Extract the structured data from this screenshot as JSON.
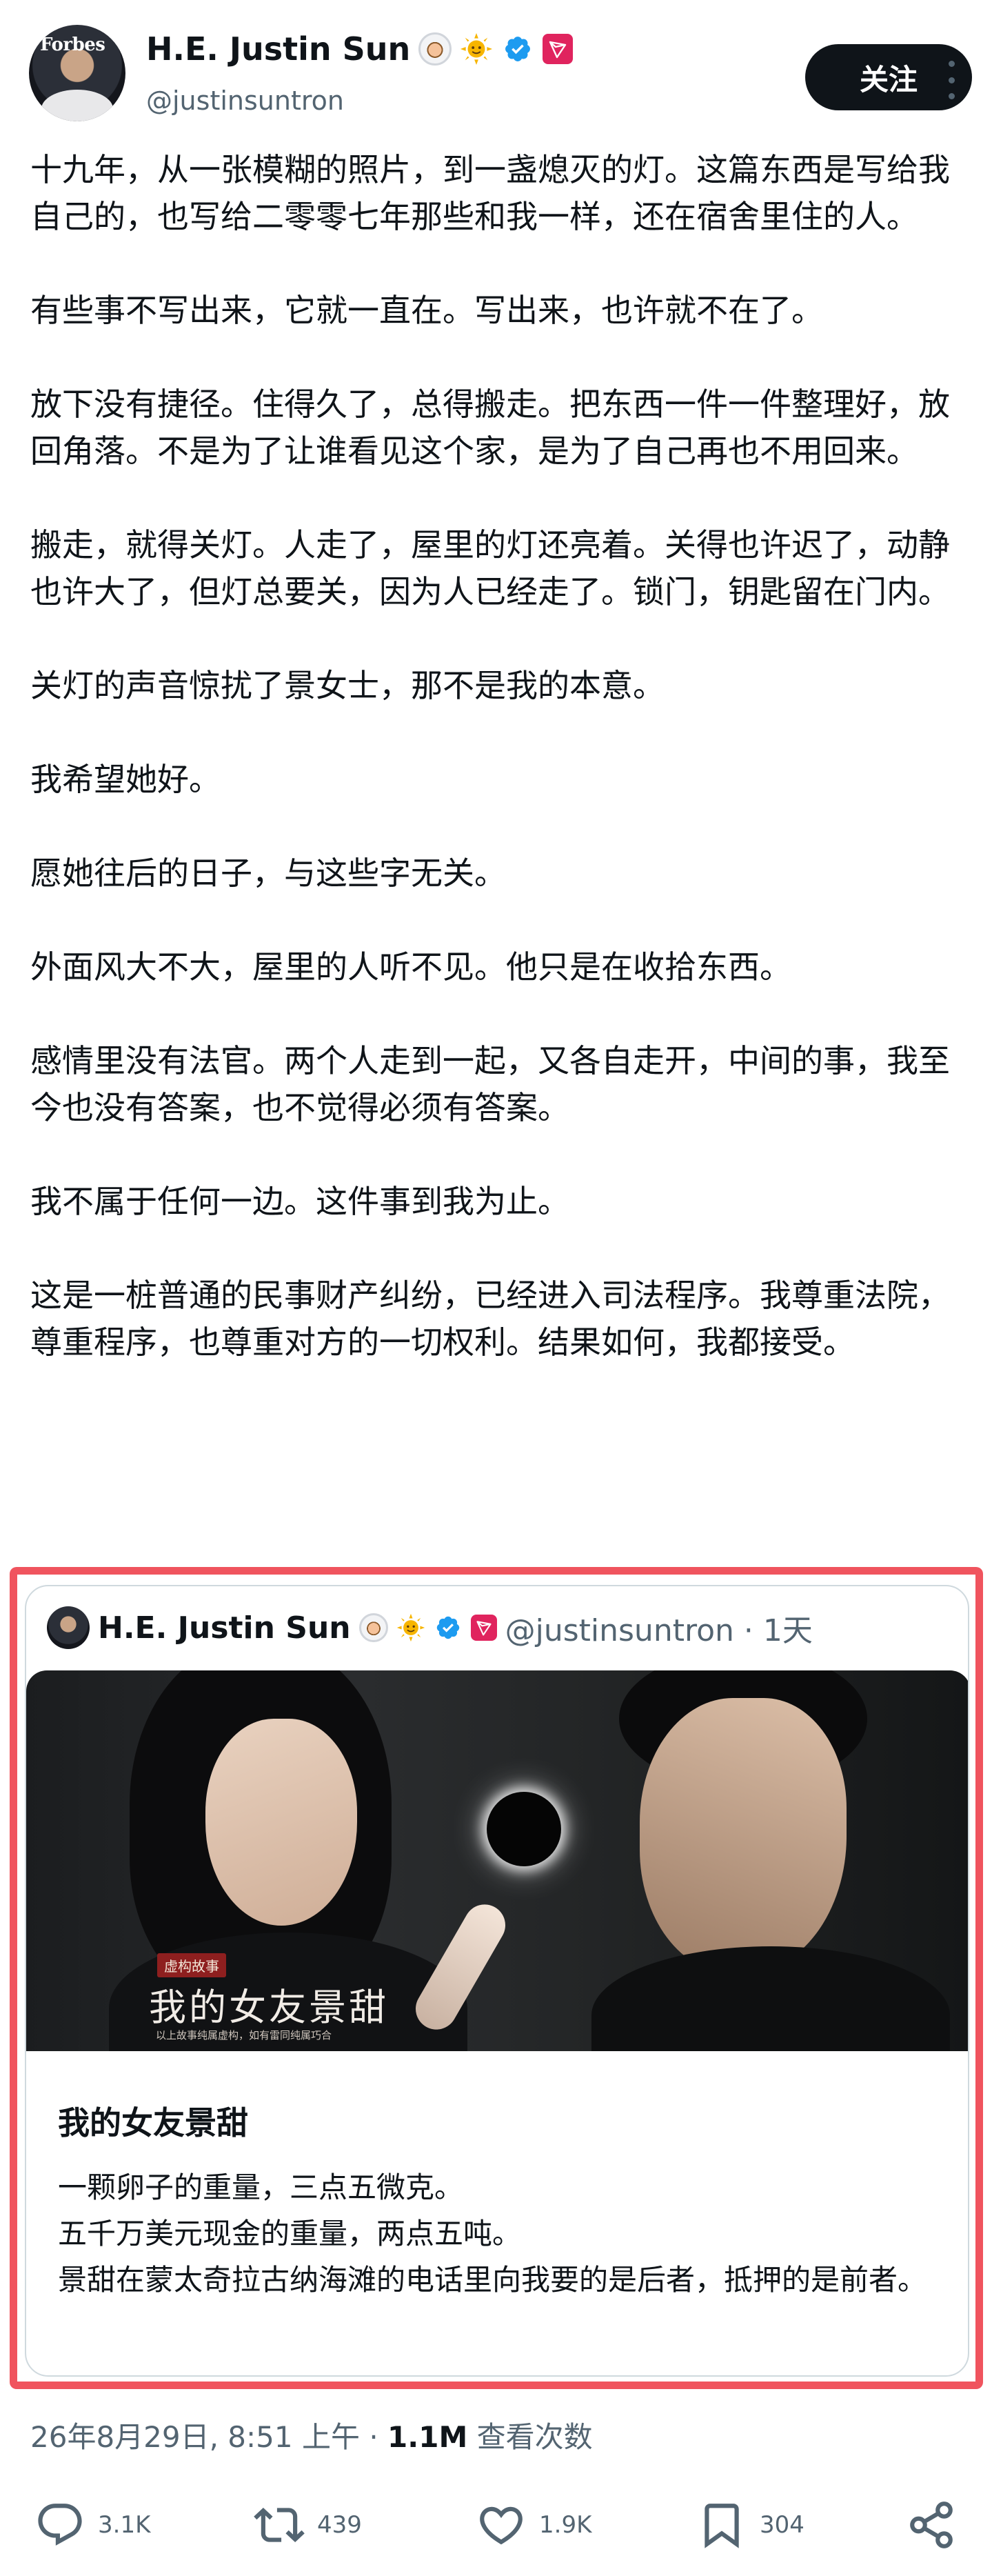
{
  "author": {
    "display_name": "H.E. Justin Sun",
    "handle": "@justinsuntron",
    "avatar_logo_text": "Forbes",
    "icons": [
      "astronaut-icon",
      "sun-icon",
      "verified-icon",
      "tron-icon"
    ]
  },
  "follow_label": "关注",
  "tweet_paragraphs": [
    "十九年，从一张模糊的照片，到一盏熄灭的灯。这篇东西是写给我自己的，也写给二零零七年那些和我一样，还在宿舍里住的人。",
    "有些事不写出来，它就一直在。写出来，也许就不在了。",
    "放下没有捷径。住得久了，总得搬走。把东西一件一件整理好，放回角落。不是为了让谁看见这个家，是为了自己再也不用回来。",
    "搬走，就得关灯。人走了，屋里的灯还亮着。关得也许迟了，动静也许大了，但灯总要关，因为人已经走了。锁门，钥匙留在门内。",
    "关灯的声音惊扰了景女士，那不是我的本意。",
    "我希望她好。",
    "愿她往后的日子，与这些字无关。",
    "外面风大不大，屋里的人听不见。他只是在收拾东西。",
    "感情里没有法官。两个人走到一起，又各自走开，中间的事，我至今也没有答案，也不觉得必须有答案。",
    "我不属于任何一边。这件事到我为止。",
    "这是一桩普通的民事财产纠纷，已经进入司法程序。我尊重法院，尊重程序，也尊重对方的一切权利。结果如何，我都接受。"
  ],
  "quote": {
    "display_name": "H.E. Justin Sun",
    "handle_time": "@justinsuntron · 1天",
    "image": {
      "tag": "虚构故事",
      "title": "我的女友景甜",
      "subtitle": "以上故事纯属虚构，如有雷同纯属巧合"
    },
    "title": "我的女友景甜",
    "lines": [
      "一颗卵子的重量，三点五微克。",
      "五千万美元现金的重量，两点五吨。",
      "景甜在蒙太奇拉古纳海滩的电话里向我要的是后者，抵押的是前者。"
    ]
  },
  "meta": {
    "timestamp": "26年8月29日, 8:51 上午",
    "separator": " · ",
    "views_count": "1.1M",
    "views_label": " 查看次数"
  },
  "actions": {
    "replies": "3.1K",
    "reposts": "439",
    "likes": "1.9K",
    "bookmarks": "304"
  },
  "colors": {
    "text": "#0f1419",
    "secondary": "#536471",
    "highlight_border": "#f0545e",
    "verified": "#1d9bf0",
    "follow_bg": "#0f1419"
  }
}
